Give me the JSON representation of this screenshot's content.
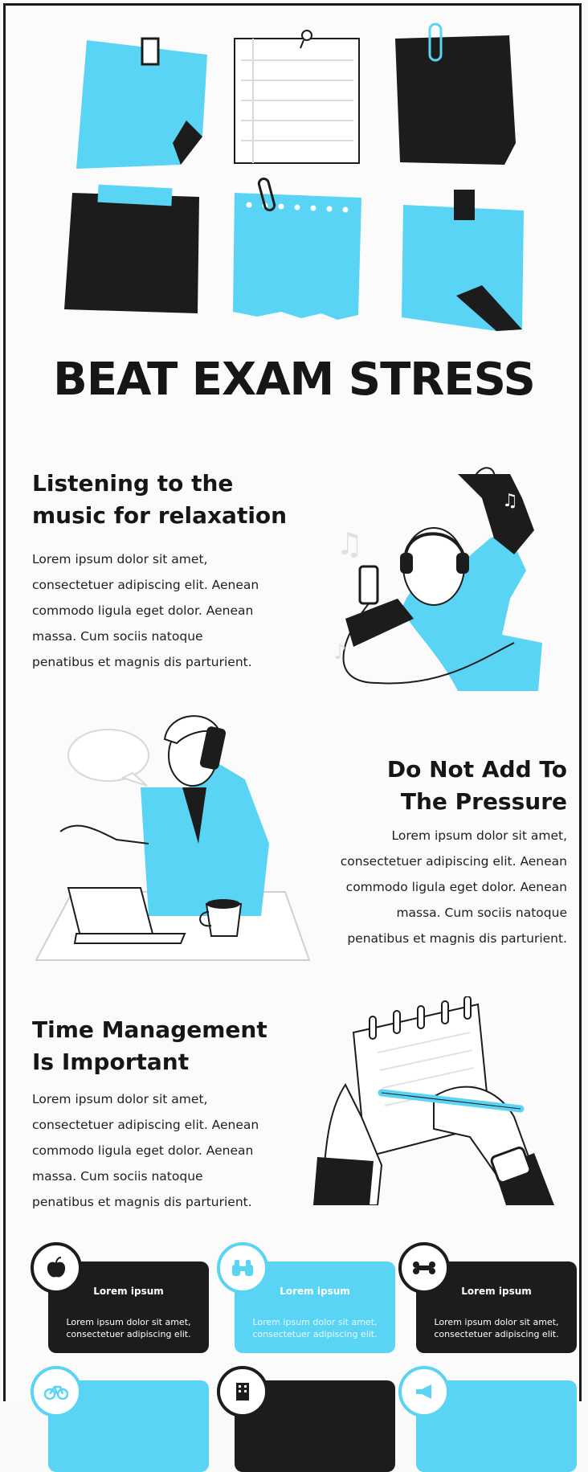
{
  "title": "BEAT EXAM STRESS",
  "sections": [
    {
      "heading_lines": [
        "Listening to the",
        "music for relaxation"
      ],
      "body_lines": [
        "Lorem ipsum dolor sit amet,",
        "consectetuer adipiscing elit. Aenean",
        "commodo ligula eget dolor. Aenean",
        "massa. Cum sociis natoque",
        "penatibus et magnis dis parturient."
      ]
    },
    {
      "heading_lines": [
        "Do Not Add To",
        "The Pressure"
      ],
      "body_lines": [
        "Lorem ipsum dolor sit amet,",
        "consectetuer adipiscing elit. Aenean",
        "commodo ligula eget dolor. Aenean",
        "massa. Cum sociis natoque",
        "penatibus et magnis dis parturient."
      ]
    },
    {
      "heading_lines": [
        "Time Management",
        "Is Important"
      ],
      "body_lines": [
        "Lorem ipsum dolor sit amet,",
        "consectetuer adipiscing elit. Aenean",
        "commodo ligula eget dolor. Aenean",
        "massa. Cum sociis natoque",
        "penatibus et magnis dis parturient."
      ]
    }
  ],
  "cards": [
    {
      "title": "Lorem ipsum",
      "body_lines": [
        "Lorem ipsum dolor sit amet,",
        "consectetuer adipiscing elit."
      ],
      "style": "dark",
      "icon": "apple-icon"
    },
    {
      "title": "Lorem ipsum",
      "body_lines": [
        "Lorem ipsum dolor sit amet,",
        "consectetuer adipiscing elit."
      ],
      "style": "blue",
      "icon": "binoculars-icon"
    },
    {
      "title": "Lorem ipsum",
      "body_lines": [
        "Lorem ipsum dolor sit amet,",
        "consectetuer adipiscing elit."
      ],
      "style": "dark",
      "icon": "bone-icon"
    }
  ],
  "bottom_icons": [
    "bicycle-icon",
    "building-icon",
    "megaphone-icon"
  ],
  "colors": {
    "accent": "#5ad4f4",
    "dark": "#1c1c1c",
    "background": "#fbfbfb"
  }
}
